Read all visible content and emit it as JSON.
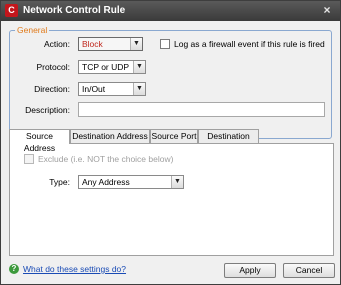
{
  "window": {
    "title": "Network Control Rule",
    "app_icon_letter": "C",
    "close_glyph": "×"
  },
  "general": {
    "group_label": "General",
    "action": {
      "label": "Action:",
      "value": "Block"
    },
    "log_checkbox": {
      "label": "Log as a firewall event if this rule is fired",
      "checked": false
    },
    "protocol": {
      "label": "Protocol:",
      "value": "TCP or UDP"
    },
    "direction": {
      "label": "Direction:",
      "value": "In/Out"
    },
    "description": {
      "label": "Description:",
      "value": ""
    }
  },
  "tabs": [
    {
      "label": "Source Address",
      "active": true
    },
    {
      "label": "Destination Address",
      "active": false
    },
    {
      "label": "Source Port",
      "active": false
    },
    {
      "label": "Destination Port",
      "active": false
    }
  ],
  "source_panel": {
    "exclude_label": "Exclude (i.e. NOT the choice below)",
    "type_label": "Type:",
    "type_value": "Any Address"
  },
  "footer": {
    "help_link": "What do these settings do?",
    "apply_label": "Apply",
    "cancel_label": "Cancel"
  },
  "colors": {
    "accent_group_label": "#e07a1a",
    "group_border": "#8aa8d0",
    "link": "#1a4bb5",
    "action_value": "#c0281e"
  }
}
